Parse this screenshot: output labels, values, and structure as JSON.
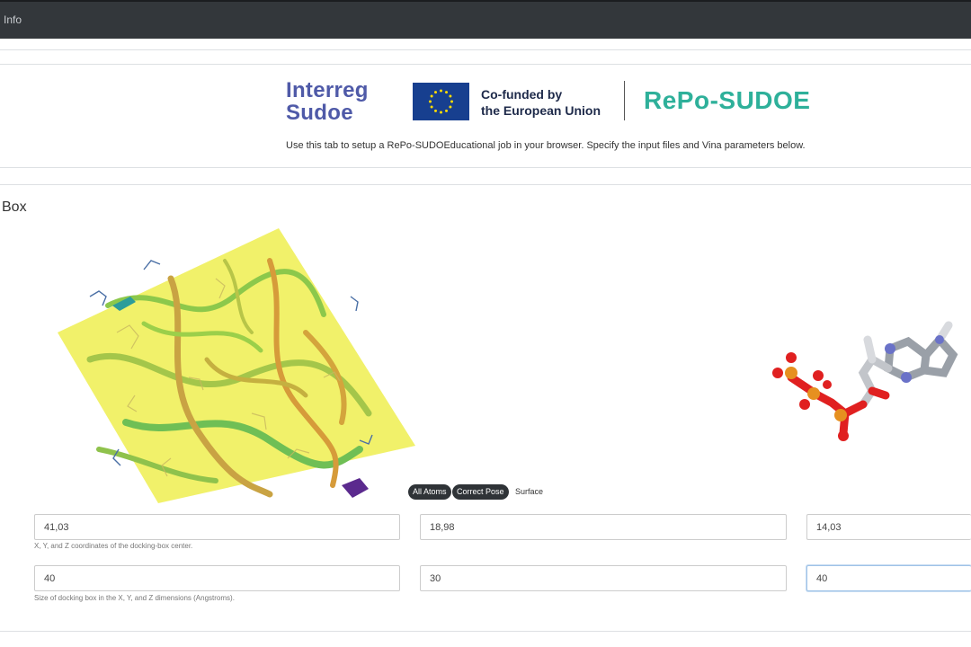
{
  "topbar": {
    "info_label": "Info"
  },
  "header": {
    "logo_line1": "Interreg",
    "logo_line2": "Sudoe",
    "cofund_line1": "Co-funded by",
    "cofund_line2": "the European Union",
    "project_name": "RePo-SUDOE",
    "description": "Use this tab to setup a RePo-SUDOEducational job in your browser. Specify the input files and Vina parameters below."
  },
  "box_section": {
    "title": "Box",
    "viewer_buttons": [
      "All Atoms",
      "Correct Pose",
      "Surface"
    ],
    "center": {
      "x": "41,03",
      "y": "18,98",
      "z": "14,03",
      "help": "X, Y, and Z coordinates of the docking-box center."
    },
    "size": {
      "x": "40",
      "y": "30",
      "z": "40",
      "help": "Size of docking box in the X, Y, and Z dimensions (Angstroms)."
    }
  },
  "colors": {
    "topbar": "#33373b",
    "box": "#f0ef5a",
    "brand_teal": "#2eb09a",
    "interreg_blue": "#4f5aa8",
    "eu_blue": "#173f8f",
    "eu_star": "#ffdd00"
  },
  "icons": [
    "eu-flag-icon"
  ]
}
